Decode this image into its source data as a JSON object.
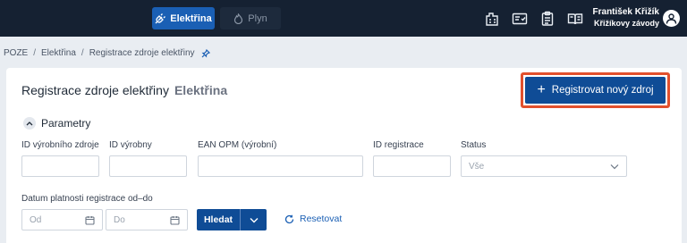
{
  "topbar": {
    "tabs": [
      {
        "label": "Elektřina",
        "icon": "plug-icon",
        "active": true
      },
      {
        "label": "Plyn",
        "icon": "flame-icon",
        "active": false
      }
    ],
    "user": {
      "name": "František Křižík",
      "company": "Křižíkovy závody"
    }
  },
  "breadcrumb": [
    "POZE",
    "Elektřina",
    "Registrace zdroje elektřiny"
  ],
  "page": {
    "title": "Registrace zdroje elektřiny",
    "subtitle": "Elektřina",
    "register_button": "Registrovat nový zdroj"
  },
  "filters": {
    "section_title": "Parametry",
    "source_id_label": "ID výrobního zdroje",
    "plant_id_label": "ID výrobny",
    "ean_label": "EAN OPM (výrobní)",
    "registration_id_label": "ID registrace",
    "status_label": "Status",
    "status_value": "Vše",
    "validity_label": "Datum platnosti registrace od–do",
    "date_from_placeholder": "Od",
    "date_to_placeholder": "Do",
    "search_button": "Hledat",
    "reset_link": "Resetovat"
  },
  "colors": {
    "primary": "#0f4c96",
    "header_bg": "#152132",
    "highlight": "#e2502d"
  }
}
